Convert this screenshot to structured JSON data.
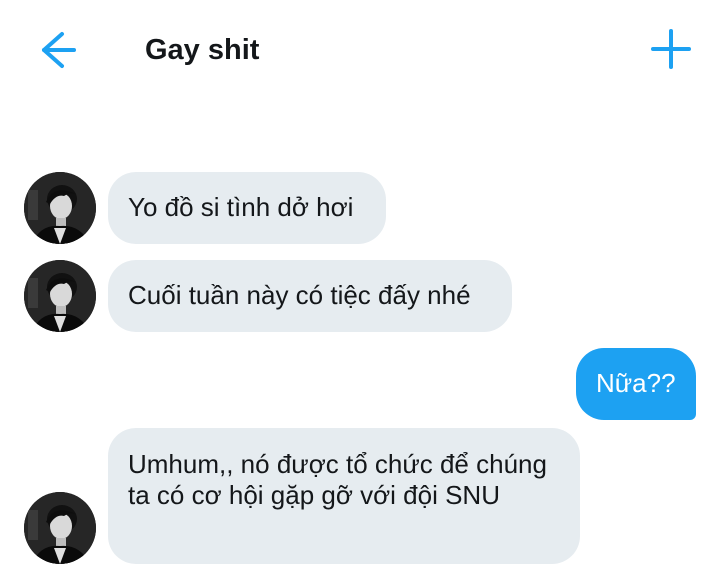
{
  "header": {
    "title": "Gay shit",
    "back_icon": "arrow-left-icon",
    "add_icon": "plus-icon",
    "accent_color": "#1da1f2"
  },
  "messages": [
    {
      "sender": "other",
      "text": "Yo đồ si tình dở hơi"
    },
    {
      "sender": "other",
      "text": "Cuối tuần này có tiệc đấy nhé"
    },
    {
      "sender": "me",
      "text": "Nữa??"
    },
    {
      "sender": "other",
      "text": "Umhum,, nó được tổ chức để chúng ta có cơ hội gặp gỡ với đội SNU"
    }
  ],
  "colors": {
    "incoming_bubble": "#e6ecf0",
    "outgoing_bubble": "#1da1f2",
    "text": "#14171a"
  }
}
